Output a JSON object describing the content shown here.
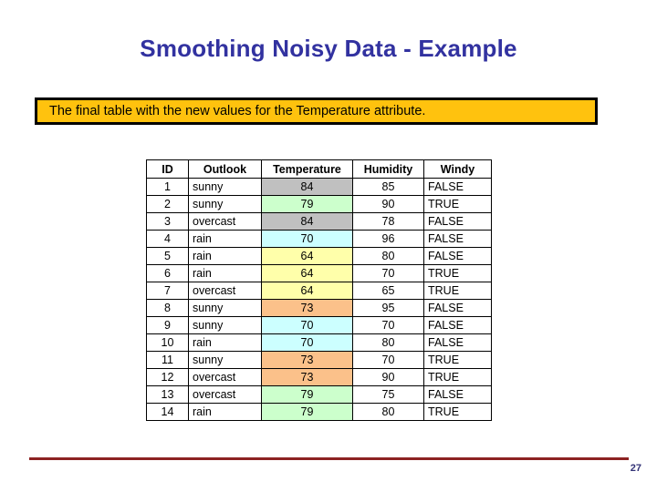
{
  "slide": {
    "title": "Smoothing Noisy Data - Example",
    "title_color": "#3232a0",
    "background_color": "#ffffff"
  },
  "callout": {
    "text": "The final table with the new values for the Temperature attribute.",
    "fill_color": "#ffc20e",
    "border_color": "#000000",
    "text_color": "#000000"
  },
  "table": {
    "columns": [
      "ID",
      "Outlook",
      "Temperature",
      "Humidity",
      "Windy"
    ],
    "rows": [
      {
        "id": "1",
        "outlook": "sunny",
        "temperature": "84",
        "temp_fill": "#c0c0c0",
        "humidity": "85",
        "windy": "FALSE"
      },
      {
        "id": "2",
        "outlook": "sunny",
        "temperature": "79",
        "temp_fill": "#ccffcc",
        "humidity": "90",
        "windy": "TRUE"
      },
      {
        "id": "3",
        "outlook": "overcast",
        "temperature": "84",
        "temp_fill": "#c0c0c0",
        "humidity": "78",
        "windy": "FALSE"
      },
      {
        "id": "4",
        "outlook": "rain",
        "temperature": "70",
        "temp_fill": "#ccffff",
        "humidity": "96",
        "windy": "FALSE"
      },
      {
        "id": "5",
        "outlook": "rain",
        "temperature": "64",
        "temp_fill": "#ffffaa",
        "humidity": "80",
        "windy": "FALSE"
      },
      {
        "id": "6",
        "outlook": "rain",
        "temperature": "64",
        "temp_fill": "#ffffaa",
        "humidity": "70",
        "windy": "TRUE"
      },
      {
        "id": "7",
        "outlook": "overcast",
        "temperature": "64",
        "temp_fill": "#ffffaa",
        "humidity": "65",
        "windy": "TRUE"
      },
      {
        "id": "8",
        "outlook": "sunny",
        "temperature": "73",
        "temp_fill": "#fbc18a",
        "humidity": "95",
        "windy": "FALSE"
      },
      {
        "id": "9",
        "outlook": "sunny",
        "temperature": "70",
        "temp_fill": "#ccffff",
        "humidity": "70",
        "windy": "FALSE"
      },
      {
        "id": "10",
        "outlook": "rain",
        "temperature": "70",
        "temp_fill": "#ccffff",
        "humidity": "80",
        "windy": "FALSE"
      },
      {
        "id": "11",
        "outlook": "sunny",
        "temperature": "73",
        "temp_fill": "#fbc18a",
        "humidity": "70",
        "windy": "TRUE"
      },
      {
        "id": "12",
        "outlook": "overcast",
        "temperature": "73",
        "temp_fill": "#fbc18a",
        "humidity": "90",
        "windy": "TRUE"
      },
      {
        "id": "13",
        "outlook": "overcast",
        "temperature": "79",
        "temp_fill": "#ccffcc",
        "humidity": "75",
        "windy": "FALSE"
      },
      {
        "id": "14",
        "outlook": "rain",
        "temperature": "79",
        "temp_fill": "#ccffcc",
        "humidity": "80",
        "windy": "TRUE"
      }
    ]
  },
  "footer": {
    "page_number": "27",
    "rule_color": "#8c2222",
    "page_number_color": "#333377"
  }
}
